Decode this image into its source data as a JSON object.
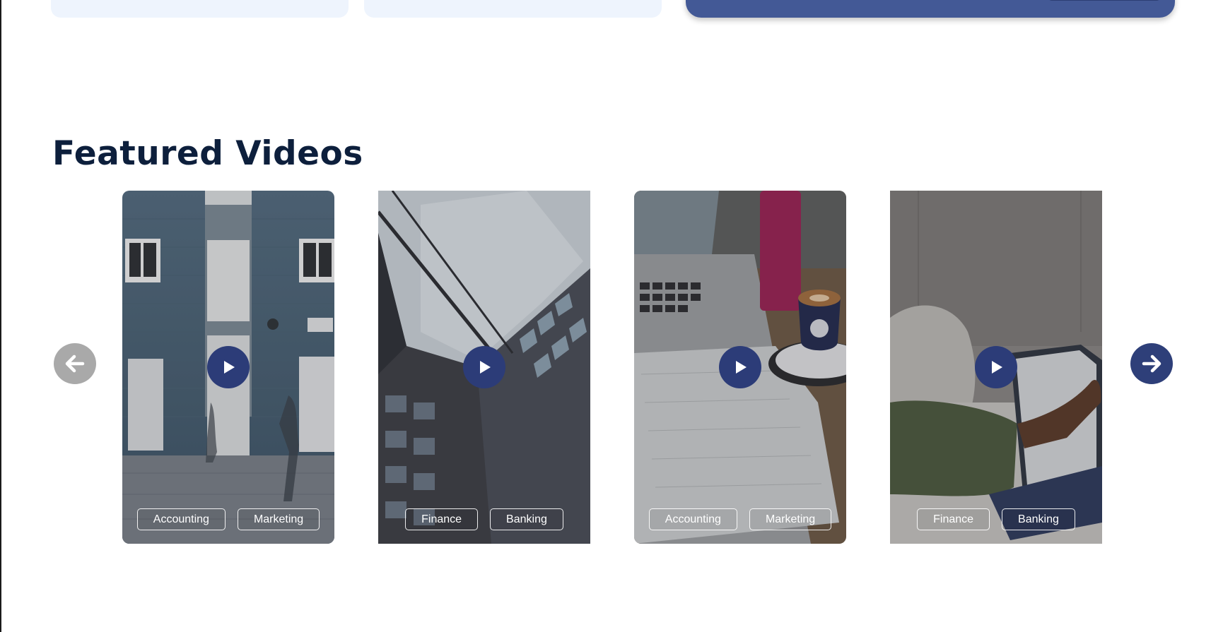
{
  "section": {
    "title": "Featured Videos"
  },
  "colors": {
    "title": "#0d1f3c",
    "accent": "#2e3f79",
    "cta_band": "#435996",
    "light_card": "#eef4fd",
    "prev_button": "#a9a9a9"
  },
  "carousel": {
    "prev_icon": "arrow-left-icon",
    "next_icon": "arrow-right-icon",
    "videos": [
      {
        "thumbnail": "blue-brick-building-with-pedestrians",
        "play_icon": "play-icon",
        "tags": [
          "Accounting",
          "Marketing"
        ]
      },
      {
        "thumbnail": "glass-office-tower-looking-up",
        "play_icon": "play-icon",
        "tags": [
          "Finance",
          "Banking"
        ]
      },
      {
        "thumbnail": "laptop-coffee-and-documents-on-desk",
        "play_icon": "play-icon",
        "tags": [
          "Accounting",
          "Marketing"
        ]
      },
      {
        "thumbnail": "person-using-laptop-on-bed",
        "play_icon": "play-icon",
        "tags": [
          "Finance",
          "Banking"
        ]
      }
    ]
  }
}
